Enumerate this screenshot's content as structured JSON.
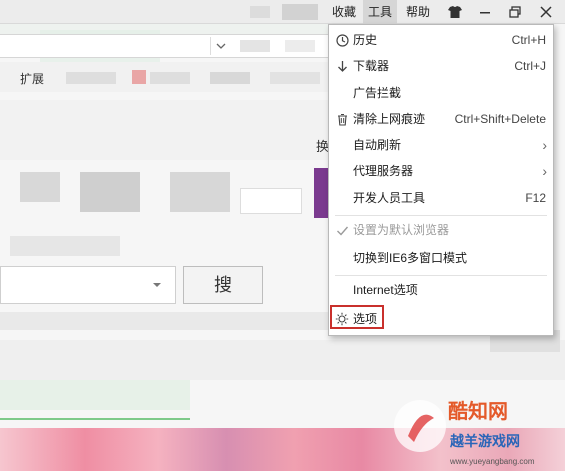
{
  "titlebar": {
    "items": [
      {
        "label": "收藏",
        "selected": false
      },
      {
        "label": "工具",
        "selected": true
      },
      {
        "label": "帮助",
        "selected": false
      }
    ],
    "window_buttons": [
      {
        "name": "shirt-icon",
        "glyph": "👕"
      },
      {
        "name": "minimize-icon",
        "glyph": "—"
      },
      {
        "name": "maximize-icon",
        "glyph": "❐"
      },
      {
        "name": "close-icon",
        "glyph": "✕"
      }
    ]
  },
  "background": {
    "fav_extensions_label": "扩展",
    "search_button_label": "搜",
    "partial_tab_label": "换"
  },
  "tools_menu": {
    "items": [
      {
        "icon": "clock-icon",
        "label": "历史",
        "shortcut": "Ctrl+H"
      },
      {
        "icon": "download-icon",
        "label": "下载器",
        "shortcut": "Ctrl+J"
      },
      {
        "icon": "",
        "label": "广告拦截",
        "shortcut": ""
      },
      {
        "icon": "trash-icon",
        "label": "清除上网痕迹",
        "shortcut": "Ctrl+Shift+Delete"
      },
      {
        "icon": "",
        "label": "自动刷新",
        "shortcut": "",
        "submenu": true
      },
      {
        "icon": "",
        "label": "代理服务器",
        "shortcut": "",
        "submenu": true
      },
      {
        "icon": "",
        "label": "开发人员工具",
        "shortcut": "F12"
      },
      {
        "icon": "check-icon",
        "label": "设置为默认浏览器",
        "shortcut": "",
        "disabled": true
      },
      {
        "icon": "",
        "label": "切换到IE6多窗口模式",
        "shortcut": ""
      },
      {
        "icon": "",
        "label": "Internet选项",
        "shortcut": ""
      },
      {
        "icon": "settings-icon",
        "label": "选项",
        "shortcut": ""
      }
    ]
  },
  "colors": {
    "highlight_border": "#c9302c",
    "menu_background": "#ffffff"
  },
  "watermark": {
    "brand": "酷知网",
    "sub_brand": "越羊游戏网",
    "url": "www.yueyangbang.com"
  }
}
